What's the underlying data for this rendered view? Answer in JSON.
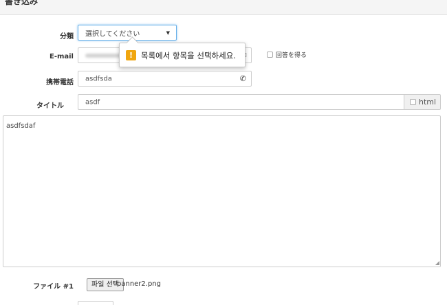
{
  "header": {
    "title": "書き込み"
  },
  "form": {
    "category": {
      "label": "分類",
      "selected": "選択してください"
    },
    "email": {
      "label": "E-mail",
      "reply_label": "回答を得る"
    },
    "tooltip": {
      "icon": "!",
      "message": "목록에서 항목을 선택하세요."
    },
    "phone": {
      "label": "携帯電話",
      "value": "asdfsda"
    },
    "title": {
      "label": "タイトル",
      "value": "asdf",
      "html_label": "html"
    },
    "content": {
      "value": "asdfsdaf"
    },
    "file": {
      "label": "ファイル #1",
      "button_label": "파일 선택",
      "file_name": "banner2.png"
    }
  },
  "icons": {
    "select_caret": "caret-down-icon",
    "email": "envelope-icon",
    "phone": "phone-icon",
    "warning": "warning-icon"
  },
  "colors": {
    "focus_border": "#66afe9",
    "warning": "#f0a60f",
    "header_bg": "#f5f5f5"
  }
}
